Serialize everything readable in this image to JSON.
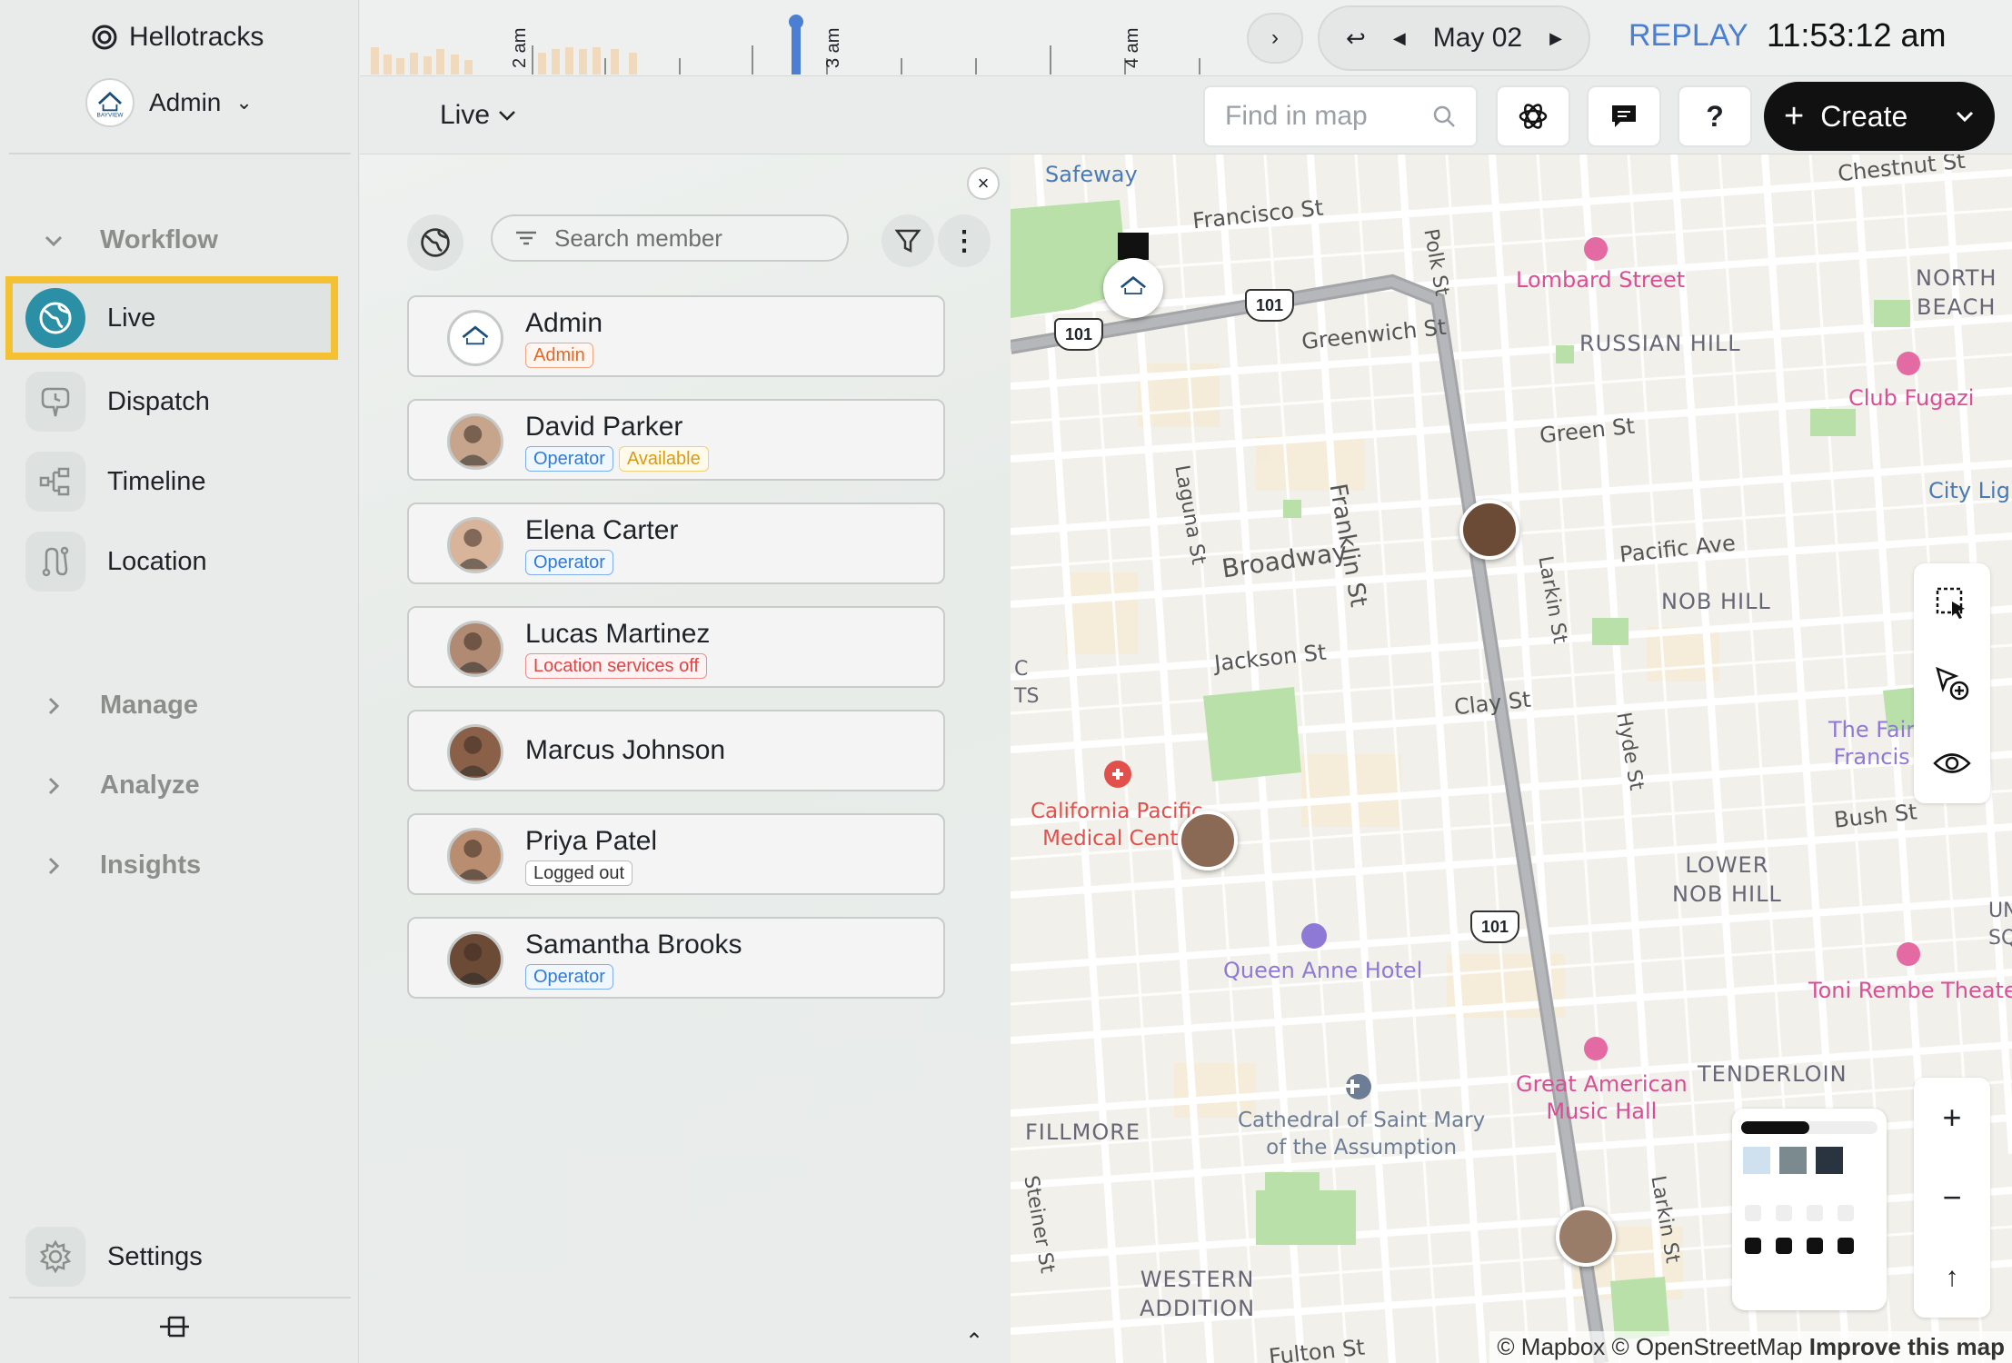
{
  "app": {
    "name": "Hellotracks"
  },
  "account": {
    "name": "Admin",
    "logo_text": "BAYVIEW"
  },
  "sidebar": {
    "workflow_label": "Workflow",
    "items": [
      {
        "label": "Live"
      },
      {
        "label": "Dispatch"
      },
      {
        "label": "Timeline"
      },
      {
        "label": "Location"
      }
    ],
    "manage_label": "Manage",
    "analyze_label": "Analyze",
    "insights_label": "Insights",
    "settings_label": "Settings"
  },
  "timeline": {
    "ticks": [
      "2 am",
      "3 am",
      "4 am"
    ],
    "date": "May 02",
    "replay_label": "REPLAY",
    "time": "11:53:12 am"
  },
  "subbar": {
    "view_label": "Live",
    "find_placeholder": "Find in map",
    "create_label": "Create"
  },
  "panel": {
    "search_placeholder": "Search member"
  },
  "members": [
    {
      "name": "Admin",
      "tags": [
        {
          "text": "Admin",
          "color": "orange"
        }
      ]
    },
    {
      "name": "David Parker",
      "tags": [
        {
          "text": "Operator",
          "color": "blue"
        },
        {
          "text": "Available",
          "color": "yellow"
        }
      ]
    },
    {
      "name": "Elena Carter",
      "tags": [
        {
          "text": "Operator",
          "color": "blue"
        }
      ]
    },
    {
      "name": "Lucas Martinez",
      "tags": [
        {
          "text": "Location services off",
          "color": "red"
        }
      ]
    },
    {
      "name": "Marcus Johnson",
      "tags": []
    },
    {
      "name": "Priya Patel",
      "tags": [
        {
          "text": "Logged out",
          "color": "gray"
        }
      ]
    },
    {
      "name": "Samantha Brooks",
      "tags": [
        {
          "text": "Operator",
          "color": "blue"
        }
      ]
    }
  ],
  "map": {
    "labels": {
      "safeway": "Safeway",
      "francisco": "Francisco St",
      "chestnut": "Chestnut St",
      "lombard": "Lombard Street",
      "north_beach": "NORTH\nBEACH",
      "greenwich": "Greenwich St",
      "russian_hill": "RUSSIAN HILL",
      "club_fugazi": "Club Fugazi",
      "green": "Green St",
      "city_lights": "City Ligh",
      "polk": "Polk St",
      "laguna": "Laguna St",
      "franklin": "Franklin St",
      "broadway": "Broadway",
      "larkin": "Larkin St",
      "pacific": "Pacific Ave",
      "nob_hill": "NOB HILL",
      "jackson": "Jackson St",
      "clay": "Clay St",
      "hyde": "Hyde St",
      "fairmont": "The Fair\nFrancis",
      "bush": "Bush St",
      "cpmc": "California Pacific\nMedical Cente",
      "lower_nob_hill": "LOWER\nNOB HILL",
      "queen_anne": "Queen Anne Hotel",
      "toni_rembe": "Toni Rembe Theater",
      "tenderloin": "TENDERLOIN",
      "great_american": "Great American\nMusic Hall",
      "fillmore": "FILLMORE",
      "cathedral": "Cathedral of Saint Mary\nof the Assumption",
      "steiner": "Steiner St",
      "larkin2": "Larkin St",
      "western_addition": "WESTERN\nADDITION",
      "fulton": "Fulton St",
      "hwy": "101",
      "c_ts": "C\nTS",
      "un_sq": "UN\nSQ"
    },
    "attribution": {
      "mapbox": "© Mapbox",
      "osm": "© OpenStreetMap",
      "improve": "Improve this map"
    }
  }
}
